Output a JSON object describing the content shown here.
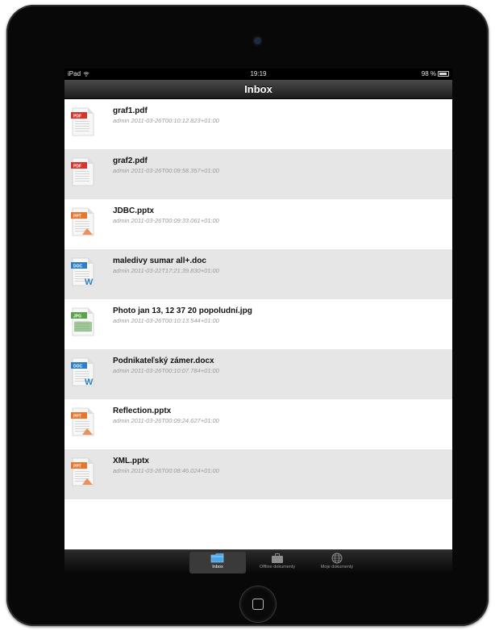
{
  "status_bar": {
    "carrier": "iPad",
    "time": "19:19",
    "battery": "98 %"
  },
  "nav": {
    "title": "Inbox"
  },
  "files": [
    {
      "name": "graf1.pdf",
      "meta": "admin 2011-03-26T00:10:12.823+01:00",
      "type": "PDF",
      "color": "#d9342b"
    },
    {
      "name": "graf2.pdf",
      "meta": "admin 2011-03-26T00:09:58.357+01:00",
      "type": "PDF",
      "color": "#d9342b"
    },
    {
      "name": "JDBC.pptx",
      "meta": "admin 2011-03-26T00:09:33.061+01:00",
      "type": "PPT",
      "color": "#e8772e"
    },
    {
      "name": "maledivy sumar all+.doc",
      "meta": "admin 2011-03-22T17:21:39.830+01:00",
      "type": "DOC",
      "color": "#2d7fc9"
    },
    {
      "name": "Photo jan 13, 12 37 20 popoludní.jpg",
      "meta": "admin 2011-03-26T00:10:13.544+01:00",
      "type": "JPG",
      "color": "#5aa34a"
    },
    {
      "name": "Podnikateľský zámer.docx",
      "meta": "admin 2011-03-26T00:10:07.784+01:00",
      "type": "DOC",
      "color": "#2d7fc9"
    },
    {
      "name": "Reflection.pptx",
      "meta": "admin 2011-03-26T00:09:24.627+01:00",
      "type": "PPT",
      "color": "#e8772e"
    },
    {
      "name": "XML.pptx",
      "meta": "admin 2011-03-26T00:08:46.024+01:00",
      "type": "PPT",
      "color": "#e8772e"
    }
  ],
  "tabs": [
    {
      "label": "Inbox",
      "icon": "folder-icon",
      "active": true
    },
    {
      "label": "Offline dokumenty",
      "icon": "briefcase-icon",
      "active": false
    },
    {
      "label": "Moje dokumenty",
      "icon": "globe-icon",
      "active": false
    }
  ]
}
